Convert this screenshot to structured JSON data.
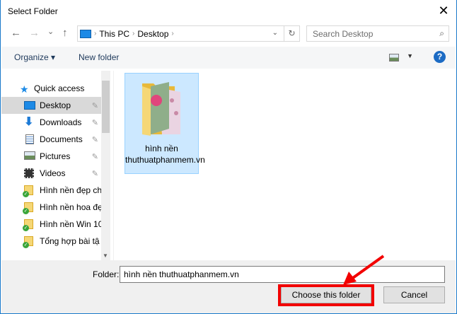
{
  "window": {
    "title": "Select Folder",
    "close": "✕"
  },
  "nav": {
    "back": "←",
    "forward": "→",
    "recent": "⌄",
    "up": "↑",
    "refresh": "↻"
  },
  "address": {
    "crumbs": [
      "This PC",
      "Desktop"
    ]
  },
  "search": {
    "placeholder": "Search Desktop"
  },
  "toolbar": {
    "organize": "Organize ▾",
    "new_folder": "New folder",
    "help": "?"
  },
  "sidebar": {
    "header": "Quick access",
    "items": [
      {
        "label": "Desktop",
        "icon": "desktop-icon",
        "pinned": true
      },
      {
        "label": "Downloads",
        "icon": "downloads-icon",
        "pinned": true
      },
      {
        "label": "Documents",
        "icon": "documents-icon",
        "pinned": true
      },
      {
        "label": "Pictures",
        "icon": "pictures-icon",
        "pinned": true
      },
      {
        "label": "Videos",
        "icon": "videos-icon",
        "pinned": true
      },
      {
        "label": "Hình nền đẹp ch",
        "icon": "folder-icon"
      },
      {
        "label": "Hình nền hoa đẹ",
        "icon": "folder-icon"
      },
      {
        "label": "Hình nền Win 10",
        "icon": "folder-icon"
      },
      {
        "label": "Tổng hợp bài tậ",
        "icon": "folder-icon"
      }
    ]
  },
  "content": {
    "items": [
      {
        "label": "hình nền thuthuatphanmem.vn"
      }
    ]
  },
  "footer": {
    "folder_label": "Folder:",
    "folder_value": "hình nền thuthuatphanmem.vn",
    "choose": "Choose this folder",
    "cancel": "Cancel"
  },
  "colors": {
    "accent": "#1979ca",
    "highlight": "#f20000",
    "selection": "#cce8ff"
  }
}
